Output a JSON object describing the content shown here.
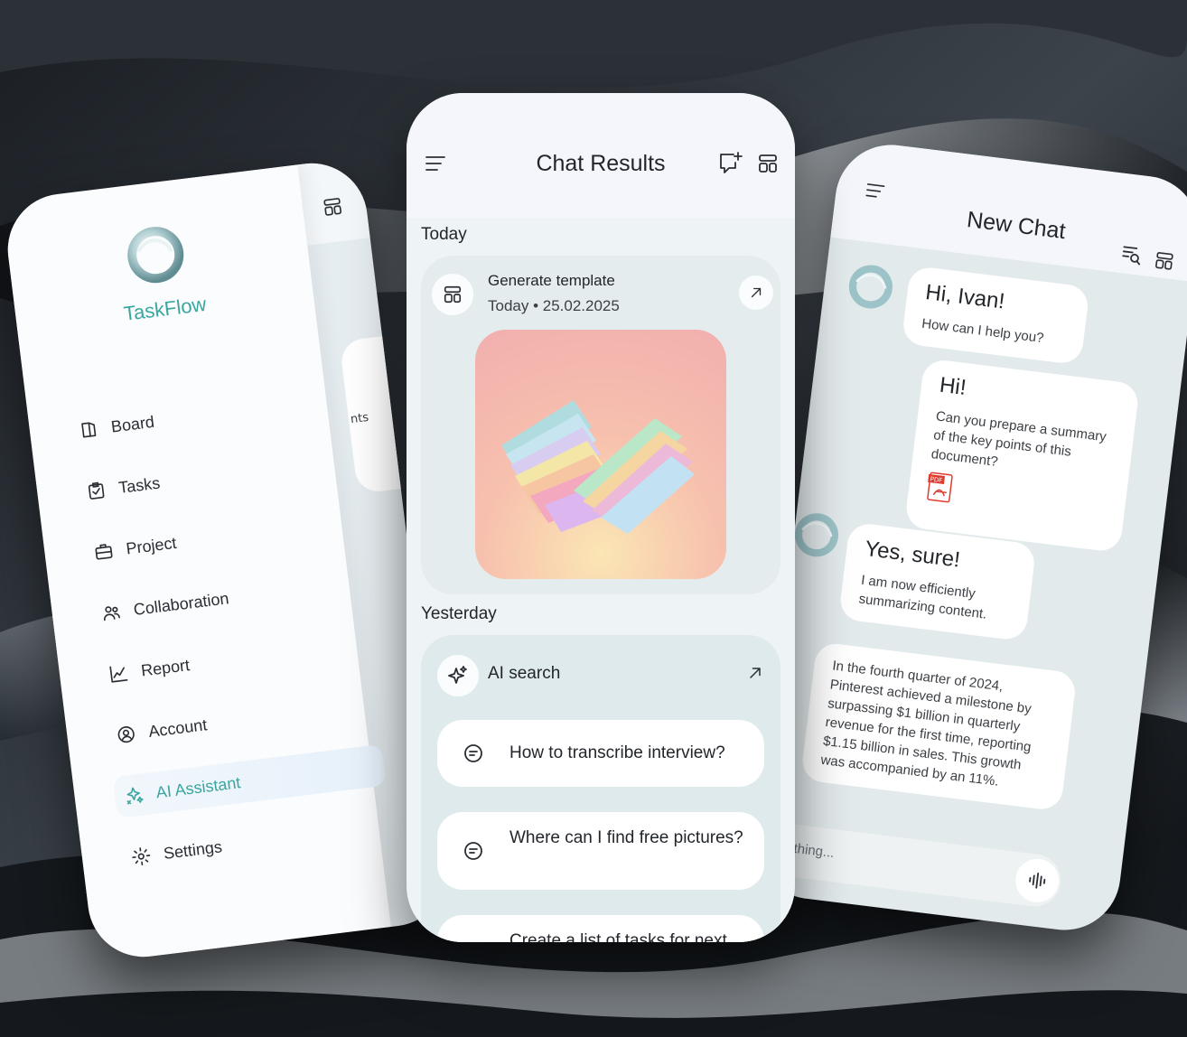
{
  "left_phone": {
    "brand": "TaskFlow",
    "peek_text": "nts",
    "nav": [
      {
        "label": "Board",
        "icon": "board-icon"
      },
      {
        "label": "Tasks",
        "icon": "tasks-icon"
      },
      {
        "label": "Project",
        "icon": "briefcase-icon"
      },
      {
        "label": "Collaboration",
        "icon": "users-icon"
      },
      {
        "label": "Report",
        "icon": "chart-icon"
      },
      {
        "label": "Account",
        "icon": "account-icon"
      },
      {
        "label": "AI Assistant",
        "icon": "ai-icon",
        "active": true
      },
      {
        "label": "Settings",
        "icon": "gear-icon"
      }
    ]
  },
  "center_phone": {
    "title": "Chat Results",
    "today_label": "Today",
    "yesterday_label": "Yesterday",
    "card1": {
      "title": "Generate template",
      "date": "Today • 25.02.2025"
    },
    "card2": {
      "title": "AI search",
      "items": [
        "How to transcribe interview?",
        "Where can I find free pictures?",
        "Create a list of tasks for next"
      ]
    }
  },
  "right_phone": {
    "title": "New Chat",
    "messages": {
      "bot1_title": "Hi, Ivan!",
      "bot1_sub": "How can I help you?",
      "user_title": "Hi!",
      "user_text": "Can you prepare a summary of the key points of this document?",
      "attachment_label": "PDF",
      "bot2_title": "Yes, sure!",
      "bot2_text": "I am now efficiently summarizing content.",
      "bot3_text": "In the fourth quarter of 2024, Pinterest achieved a milestone by surpassing $1 billion in quarterly revenue for the first time, reporting $1.15 billion in sales. This growth was accompanied by an 11%."
    },
    "input_placeholder": "anything..."
  },
  "colors": {
    "accent": "#3aa6a0",
    "text": "#22262b",
    "card": "#e4ecee"
  }
}
